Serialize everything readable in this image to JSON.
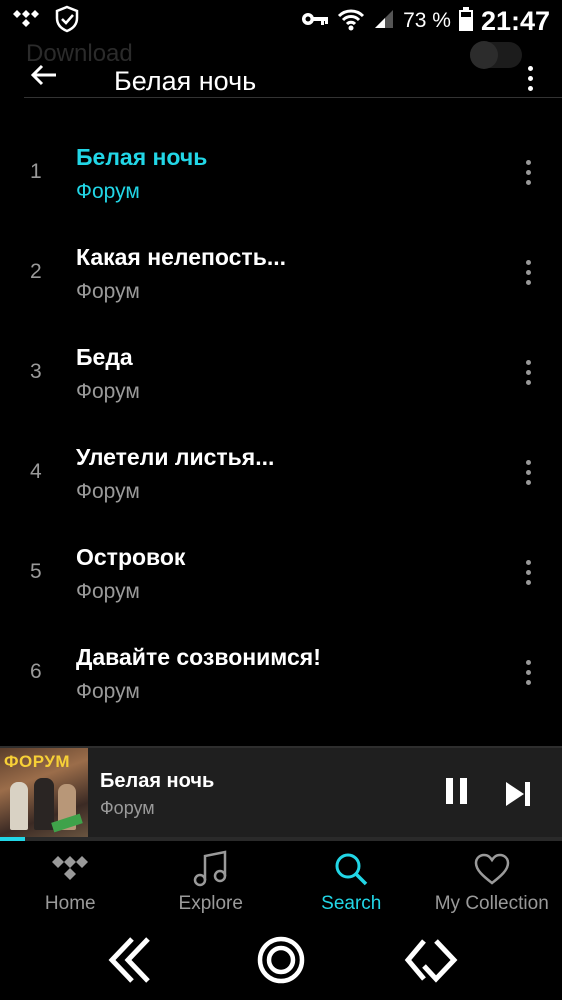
{
  "status_bar": {
    "battery_percent": "73 %",
    "time": "21:47",
    "icons": [
      "tidal-icon",
      "shield-check-icon",
      "key-icon",
      "wifi-icon",
      "signal-icon",
      "battery-icon"
    ]
  },
  "background": {
    "download_label": "Download"
  },
  "header": {
    "title": "Белая ночь"
  },
  "tracks": [
    {
      "number": "1",
      "title": "Белая ночь",
      "artist": "Форум",
      "playing": true
    },
    {
      "number": "2",
      "title": "Какая нелепость...",
      "artist": "Форум",
      "playing": false
    },
    {
      "number": "3",
      "title": "Беда",
      "artist": "Форум",
      "playing": false
    },
    {
      "number": "4",
      "title": "Улетели листья...",
      "artist": "Форум",
      "playing": false
    },
    {
      "number": "5",
      "title": "Островок",
      "artist": "Форум",
      "playing": false
    },
    {
      "number": "6",
      "title": "Давайте созвонимся!",
      "artist": "Форум",
      "playing": false
    }
  ],
  "mini_player": {
    "cover_text": "ФОРУМ",
    "title": "Белая ночь",
    "artist": "Форум",
    "progress": 0.045
  },
  "bottom_nav": [
    {
      "label": "Home",
      "icon": "home-icon",
      "active": false
    },
    {
      "label": "Explore",
      "icon": "music-note-icon",
      "active": false
    },
    {
      "label": "Search",
      "icon": "search-icon",
      "active": true
    },
    {
      "label": "My Collection",
      "icon": "heart-icon",
      "active": false
    }
  ],
  "colors": {
    "accent": "#22d6e6",
    "background": "#000000",
    "secondary_text": "#9a9a9a"
  }
}
